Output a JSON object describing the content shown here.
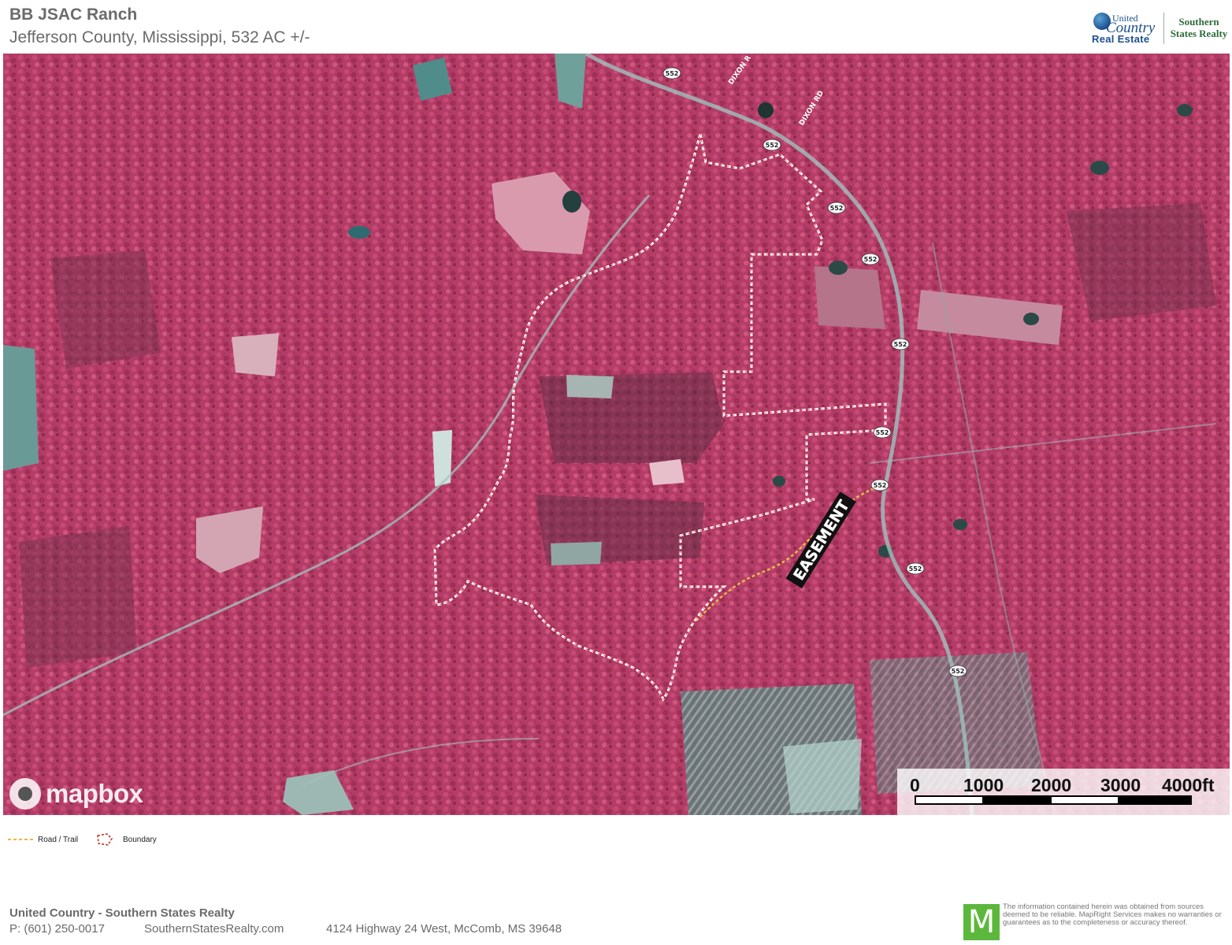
{
  "header": {
    "title": "BB JSAC Ranch",
    "subtitle": "Jefferson County, Mississippi, 532 AC +/-"
  },
  "logo": {
    "united": "United",
    "country": "Country",
    "real_estate": "Real Estate",
    "southern_line1": "Southern",
    "southern_line2": "States Realty"
  },
  "map": {
    "road_shields": [
      "552",
      "552",
      "552",
      "552",
      "552",
      "552",
      "552",
      "552",
      "552"
    ],
    "road_labels": [
      "DIXON R",
      "DIXON RD"
    ],
    "easement_label": "EASEMENT",
    "attribution": "mapbox",
    "colors": {
      "vegetation": "#b33d66",
      "boundary": "#ffffff",
      "easement": "#e8b84a"
    }
  },
  "scale": {
    "labels": [
      "0",
      "1000",
      "2000",
      "3000",
      "4000ft"
    ]
  },
  "legend": {
    "road_trail": "Road / Trail",
    "boundary": "Boundary"
  },
  "footer": {
    "company": "United Country - Southern States Realty",
    "phone": "P: (601) 250-0017",
    "website": "SouthernStatesRealty.com",
    "address": "4124 Highway 24 West, McComb, MS 39648",
    "disclaimer": "The information contained herein was obtained from sources deemed to be reliable. MapRight Services makes no warranties or guarantees as to the completeness or accuracy thereof.",
    "maprights_icon_letter": "M"
  }
}
